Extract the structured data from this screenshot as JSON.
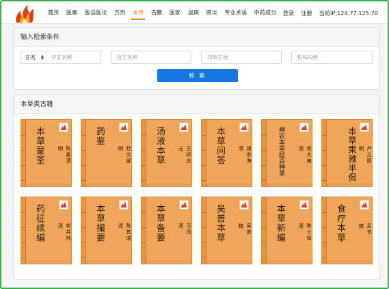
{
  "nav": {
    "items": [
      "首页",
      "医案",
      "医话医论",
      "方剂",
      "本草",
      "古籍",
      "医家",
      "温病",
      "肺炎",
      "专业术语",
      "中药成分"
    ],
    "active_index": 4,
    "login": "登录",
    "register": "注册",
    "ip_text": "当前IP:124.77.125.70"
  },
  "search": {
    "heading": "输入检索条件",
    "select_value": "正名",
    "field1_placeholder": "中文名称",
    "field2_placeholder": "拉丁名称",
    "field3_placeholder": "功效主治",
    "field4_placeholder": "性味归经",
    "button_label": "检 索"
  },
  "books": {
    "heading": "本草类古籍",
    "items": [
      {
        "title": "本草蒙筌",
        "dynasty": "明",
        "author": "陈嘉谟"
      },
      {
        "title": "药鉴",
        "dynasty": "明",
        "author": "杜文燮"
      },
      {
        "title": "汤液本草",
        "dynasty": "元",
        "author": "王好古"
      },
      {
        "title": "本草问答",
        "dynasty": "清",
        "author": "唐宗海"
      },
      {
        "title": "神农本草经百种录",
        "dynasty": "清",
        "author": "徐大椿"
      },
      {
        "title": "本草乘雅半偈",
        "dynasty": "明",
        "author": "卢之颐"
      },
      {
        "title": "药征续编",
        "dynasty": "清",
        "author": "邨井杶"
      },
      {
        "title": "本草撮要",
        "dynasty": "清",
        "author": "陈其瑞"
      },
      {
        "title": "本草备要",
        "dynasty": "清",
        "author": "汪昂"
      },
      {
        "title": "吴普本草",
        "dynasty": "魏",
        "author": "吴普"
      },
      {
        "title": "本草新编",
        "dynasty": "清",
        "author": "陈士铎"
      },
      {
        "title": "食疗本草",
        "dynasty": "唐",
        "author": "孟诜"
      }
    ]
  },
  "colors": {
    "accent": "#f08a1e",
    "button_blue": "#1677e0",
    "book_cover": "#f0a65a",
    "frame_green": "#2fb24c"
  }
}
